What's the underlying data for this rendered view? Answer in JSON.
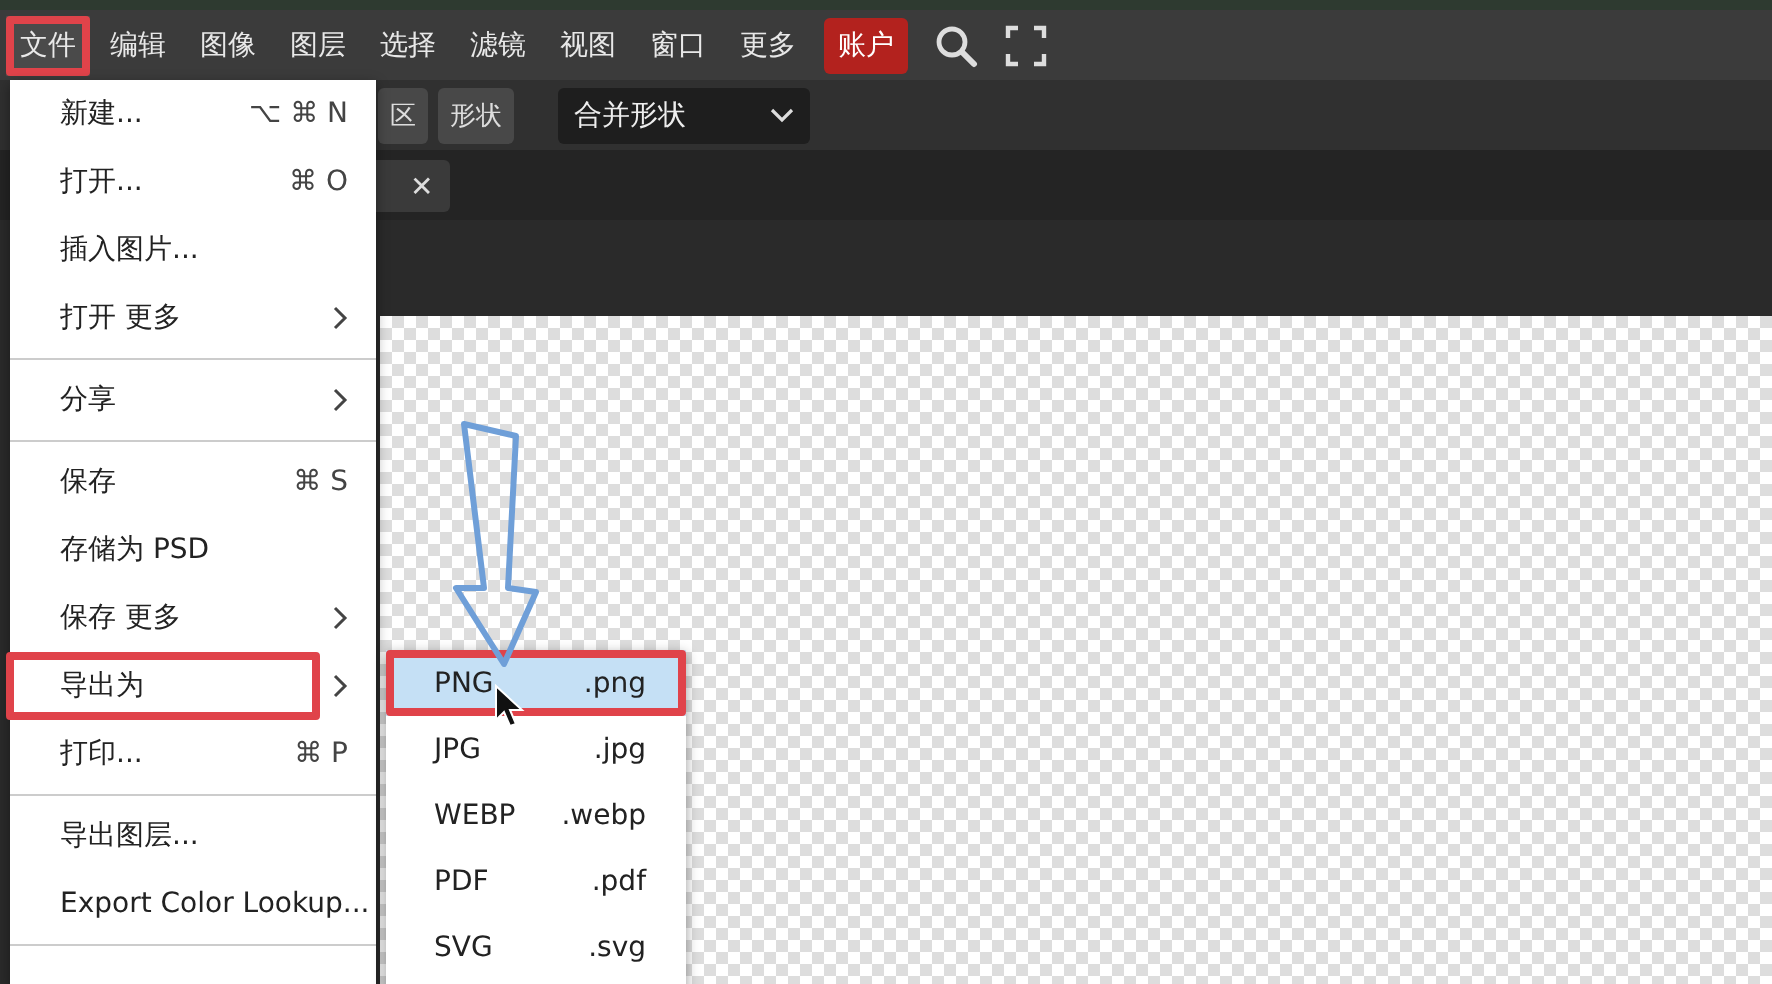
{
  "menubar": {
    "items": [
      {
        "label": "文件",
        "selected": true,
        "highlighted": true
      },
      {
        "label": "编辑",
        "selected": false,
        "highlighted": false
      },
      {
        "label": "图像",
        "selected": false,
        "highlighted": false
      },
      {
        "label": "图层",
        "selected": false,
        "highlighted": false
      },
      {
        "label": "选择",
        "selected": false,
        "highlighted": false
      },
      {
        "label": "滤镜",
        "selected": false,
        "highlighted": false
      },
      {
        "label": "视图",
        "selected": false,
        "highlighted": false
      },
      {
        "label": "窗口",
        "selected": false,
        "highlighted": false
      },
      {
        "label": "更多",
        "selected": false,
        "highlighted": false
      }
    ],
    "account_button": "账户"
  },
  "options_bar": {
    "mode_buttons": [
      "区",
      "形状"
    ],
    "combine_dropdown": "合并形状"
  },
  "document_tab": {
    "close": "✕"
  },
  "file_menu": {
    "items": [
      {
        "kind": "item",
        "label": "新建...",
        "shortcut": "⌥ ⌘ N"
      },
      {
        "kind": "item",
        "label": "打开...",
        "shortcut": "⌘ O"
      },
      {
        "kind": "item",
        "label": "插入图片..."
      },
      {
        "kind": "submenu",
        "label": "打开 更多"
      },
      {
        "kind": "separator"
      },
      {
        "kind": "submenu",
        "label": "分享"
      },
      {
        "kind": "separator"
      },
      {
        "kind": "item",
        "label": "保存",
        "shortcut": "⌘ S"
      },
      {
        "kind": "item",
        "label": "存储为 PSD"
      },
      {
        "kind": "submenu",
        "label": "保存 更多"
      },
      {
        "kind": "submenu",
        "label": "导出为",
        "highlighted": true
      },
      {
        "kind": "item",
        "label": "打印...",
        "shortcut": "⌘ P"
      },
      {
        "kind": "separator"
      },
      {
        "kind": "item",
        "label": "导出图层..."
      },
      {
        "kind": "item",
        "label": "Export Color Lookup..."
      },
      {
        "kind": "separator"
      }
    ]
  },
  "export_submenu": {
    "items": [
      {
        "format": "PNG",
        "extension": ".png",
        "selected": true,
        "highlighted": true
      },
      {
        "format": "JPG",
        "extension": ".jpg",
        "selected": false,
        "highlighted": false
      },
      {
        "format": "WEBP",
        "extension": ".webp",
        "selected": false,
        "highlighted": false
      },
      {
        "format": "PDF",
        "extension": ".pdf",
        "selected": false,
        "highlighted": false
      },
      {
        "format": "SVG",
        "extension": ".svg",
        "selected": false,
        "highlighted": false
      }
    ]
  }
}
